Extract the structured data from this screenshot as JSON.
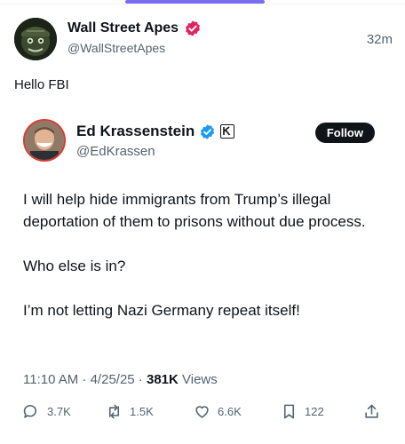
{
  "post": {
    "author_name": "Wall Street Apes",
    "author_handle": "@WallStreetApes",
    "time": "32m",
    "text": "Hello FBI"
  },
  "quoted": {
    "author_name": "Ed Krassenstein",
    "author_handle": "@EdKrassen",
    "follow_label": "Follow",
    "paragraphs": [
      "I will help hide immigrants from Trump’s illegal deportation of them to prisons without due process.",
      "Who else is in?",
      "I’m not letting Nazi Germany repeat itself!"
    ],
    "timestamp": "11:10 AM · 4/25/25 · ",
    "views_count": "381K",
    "views_label": " Views",
    "actions": {
      "replies": "3.7K",
      "reposts": "1.5K",
      "likes": "6.6K",
      "bookmarks": "122"
    }
  },
  "colors": {
    "accent_tab": "#7b6cf0",
    "verified_pink": "#e0245e",
    "verified_blue": "#1d9bf0",
    "text_primary": "#0f1419",
    "text_secondary": "#536471"
  },
  "icons": [
    "verified-badge-icon",
    "affiliate-badge-icon",
    "reply-icon",
    "repost-icon",
    "like-icon",
    "bookmark-icon",
    "share-icon"
  ]
}
